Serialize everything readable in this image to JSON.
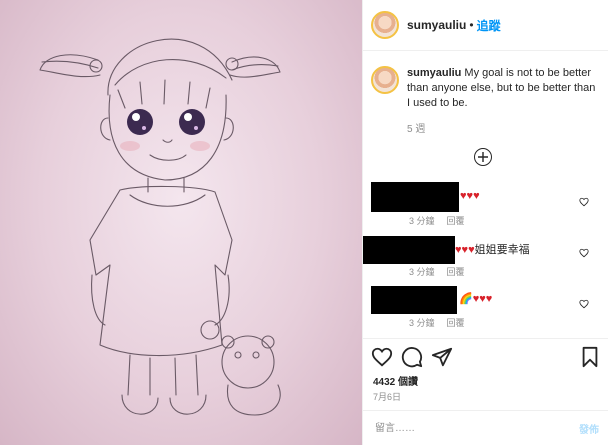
{
  "post": {
    "username": "sumyauliu",
    "follow_label": "追蹤",
    "caption": "My goal is not to be better than anyone else, but to be better than I used to be.",
    "caption_time": "5 週",
    "likes": "4432 個讚",
    "date": "7月6日"
  },
  "comments": [
    {
      "text": "♥♥♥",
      "time": "3 分鐘",
      "reply_label": "回覆"
    },
    {
      "text": "♥♥♥姐姐要幸福",
      "time": "3 分鐘",
      "reply_label": "回覆"
    },
    {
      "text": "🌈♥♥♥",
      "time": "3 分鐘",
      "reply_label": "回覆"
    }
  ],
  "input": {
    "placeholder": "留言……",
    "post_label": "發佈"
  },
  "colors": {
    "accent": "#0095f6",
    "heart": "#d8222b",
    "muted": "#8e8e8e",
    "post_disabled": "#b2dffc"
  },
  "icons": [
    "heart-icon",
    "comment-icon",
    "share-icon",
    "bookmark-icon",
    "add-circle-icon"
  ]
}
